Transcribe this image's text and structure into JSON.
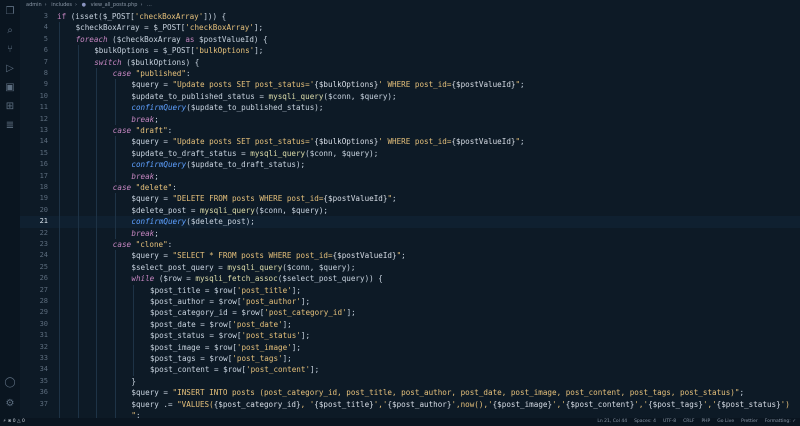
{
  "breadcrumb": [
    "admin",
    "includes",
    "view_all_posts.php",
    "..."
  ],
  "status": {
    "remote": "⚡",
    "errors": "⊗ 0 △ 0",
    "items": [
      "Ln 21, Col 44",
      "Spaces: 4",
      "UTF-8",
      "CRLF",
      "PHP",
      "Go Live",
      "Prettier",
      "Formatting: ✓"
    ]
  },
  "editor": {
    "active_line": 21
  },
  "code_lines": [
    {
      "n": 3,
      "i": 0,
      "t": [
        [
          "kw2",
          "if "
        ],
        [
          "op",
          "(isset($_POST["
        ],
        [
          "str",
          "'checkBoxArray'"
        ],
        [
          "op",
          "])) {"
        ]
      ]
    },
    {
      "n": 4,
      "i": 1,
      "t": [
        [
          "var",
          "$checkBoxArray = $_POST["
        ],
        [
          "str",
          "'checkBoxArray'"
        ],
        [
          "op",
          "];"
        ]
      ]
    },
    {
      "n": 5,
      "i": 1,
      "t": [
        [
          "kw",
          "foreach "
        ],
        [
          "op",
          "($checkBoxArray "
        ],
        [
          "kw2",
          "as "
        ],
        [
          "var",
          "$postValueId) {"
        ]
      ]
    },
    {
      "n": 6,
      "i": 2,
      "t": [
        [
          "var",
          "$bulkOptions = $_POST["
        ],
        [
          "str",
          "'bulkOptions'"
        ],
        [
          "op",
          "];"
        ]
      ]
    },
    {
      "n": 7,
      "i": 2,
      "t": [
        [
          "kw",
          "switch "
        ],
        [
          "op",
          "($bulkOptions) {"
        ]
      ]
    },
    {
      "n": 8,
      "i": 3,
      "t": [
        [
          "kw",
          "case "
        ],
        [
          "str",
          "\"published\""
        ],
        [
          "op",
          ":"
        ]
      ]
    },
    {
      "n": 9,
      "i": 4,
      "t": [
        [
          "var",
          "$query = "
        ],
        [
          "str",
          "\"Update posts SET post_status='"
        ],
        [
          "strv",
          "{$bulkOptions}"
        ],
        [
          "str",
          "' WHERE post_id="
        ],
        [
          "strv",
          "{$postValueId}"
        ],
        [
          "str",
          "\""
        ],
        [
          "op",
          ";"
        ]
      ]
    },
    {
      "n": 10,
      "i": 4,
      "t": [
        [
          "var",
          "$update_to_published_status = "
        ],
        [
          "fn",
          "mysqli_query"
        ],
        [
          "op",
          "($conn, $query);"
        ]
      ]
    },
    {
      "n": 11,
      "i": 4,
      "t": [
        [
          "fni",
          "confirmQuery"
        ],
        [
          "op",
          "($update_to_published_status);"
        ]
      ]
    },
    {
      "n": 12,
      "i": 4,
      "t": [
        [
          "kw",
          "break"
        ],
        [
          "op",
          ";"
        ]
      ]
    },
    {
      "n": 13,
      "i": 3,
      "t": [
        [
          "kw",
          "case "
        ],
        [
          "str",
          "\"draft\""
        ],
        [
          "op",
          ":"
        ]
      ]
    },
    {
      "n": 14,
      "i": 4,
      "t": [
        [
          "var",
          "$query = "
        ],
        [
          "str",
          "\"Update posts SET post_status='"
        ],
        [
          "strv",
          "{$bulkOptions}"
        ],
        [
          "str",
          "' WHERE post_id="
        ],
        [
          "strv",
          "{$postValueId}"
        ],
        [
          "str",
          "\""
        ],
        [
          "op",
          ";"
        ]
      ]
    },
    {
      "n": 15,
      "i": 4,
      "t": [
        [
          "var",
          "$update_to_draft_status = "
        ],
        [
          "fn",
          "mysqli_query"
        ],
        [
          "op",
          "($conn, $query);"
        ]
      ]
    },
    {
      "n": 16,
      "i": 4,
      "t": [
        [
          "fni",
          "confirmQuery"
        ],
        [
          "op",
          "($update_to_draft_status);"
        ]
      ]
    },
    {
      "n": 17,
      "i": 4,
      "t": [
        [
          "kw",
          "break"
        ],
        [
          "op",
          ";"
        ]
      ]
    },
    {
      "n": 18,
      "i": 3,
      "t": [
        [
          "kw",
          "case "
        ],
        [
          "str",
          "\"delete\""
        ],
        [
          "op",
          ":"
        ]
      ]
    },
    {
      "n": 19,
      "i": 4,
      "t": [
        [
          "var",
          "$query = "
        ],
        [
          "str",
          "\"DELETE FROM posts WHERE post_id="
        ],
        [
          "strv",
          "{$postValueId}"
        ],
        [
          "str",
          "\""
        ],
        [
          "op",
          ";"
        ]
      ]
    },
    {
      "n": 20,
      "i": 4,
      "t": [
        [
          "var",
          "$delete_post = "
        ],
        [
          "fn",
          "mysqli_query"
        ],
        [
          "op",
          "($conn, $query);"
        ]
      ]
    },
    {
      "n": 21,
      "i": 4,
      "t": [
        [
          "fni",
          "confirmQuery"
        ],
        [
          "op",
          "($delete_post);"
        ]
      ]
    },
    {
      "n": 22,
      "i": 4,
      "t": [
        [
          "kw",
          "break"
        ],
        [
          "op",
          ";"
        ]
      ]
    },
    {
      "n": 23,
      "i": 3,
      "t": [
        [
          "kw",
          "case "
        ],
        [
          "str",
          "\"clone\""
        ],
        [
          "op",
          ":"
        ]
      ]
    },
    {
      "n": 24,
      "i": 4,
      "t": [
        [
          "var",
          "$query = "
        ],
        [
          "str",
          "\"SELECT * FROM posts WHERE post_id="
        ],
        [
          "strv",
          "{$postValueId}"
        ],
        [
          "str",
          "\""
        ],
        [
          "op",
          ";"
        ]
      ]
    },
    {
      "n": 25,
      "i": 4,
      "t": [
        [
          "var",
          "$select_post_query = "
        ],
        [
          "fn",
          "mysqli_query"
        ],
        [
          "op",
          "($conn, $query);"
        ]
      ]
    },
    {
      "n": 26,
      "i": 4,
      "t": [
        [
          "kw",
          "while "
        ],
        [
          "op",
          "($row = "
        ],
        [
          "fn",
          "mysqli_fetch_assoc"
        ],
        [
          "op",
          "($select_post_query)) {"
        ]
      ]
    },
    {
      "n": 27,
      "i": 5,
      "t": [
        [
          "var",
          "$post_title = $row["
        ],
        [
          "str",
          "'post_title'"
        ],
        [
          "op",
          "];"
        ]
      ]
    },
    {
      "n": 28,
      "i": 5,
      "t": [
        [
          "var",
          "$post_author = $row["
        ],
        [
          "str",
          "'post_author'"
        ],
        [
          "op",
          "];"
        ]
      ]
    },
    {
      "n": 29,
      "i": 5,
      "t": [
        [
          "var",
          "$post_category_id = $row["
        ],
        [
          "str",
          "'post_category_id'"
        ],
        [
          "op",
          "];"
        ]
      ]
    },
    {
      "n": 30,
      "i": 5,
      "t": [
        [
          "var",
          "$post_date = $row["
        ],
        [
          "str",
          "'post_date'"
        ],
        [
          "op",
          "];"
        ]
      ]
    },
    {
      "n": 31,
      "i": 5,
      "t": [
        [
          "var",
          "$post_status = $row["
        ],
        [
          "str",
          "'post_status'"
        ],
        [
          "op",
          "];"
        ]
      ]
    },
    {
      "n": 32,
      "i": 5,
      "t": [
        [
          "var",
          "$post_image = $row["
        ],
        [
          "str",
          "'post_image'"
        ],
        [
          "op",
          "];"
        ]
      ]
    },
    {
      "n": 33,
      "i": 5,
      "t": [
        [
          "var",
          "$post_tags = $row["
        ],
        [
          "str",
          "'post_tags'"
        ],
        [
          "op",
          "];"
        ]
      ]
    },
    {
      "n": 34,
      "i": 5,
      "t": [
        [
          "var",
          "$post_content = $row["
        ],
        [
          "str",
          "'post_content'"
        ],
        [
          "op",
          "];"
        ]
      ]
    },
    {
      "n": 35,
      "i": 4,
      "t": [
        [
          "op",
          "}"
        ]
      ]
    },
    {
      "n": 36,
      "i": 4,
      "t": [
        [
          "var",
          "$query = "
        ],
        [
          "str",
          "\"INSERT INTO posts (post_category_id, post_title, post_author, post_date, post_image, post_content, post_tags, post_status)\""
        ],
        [
          "op",
          ";"
        ]
      ]
    },
    {
      "n": 37,
      "i": 4,
      "t": [
        [
          "var",
          "$query .= "
        ],
        [
          "str",
          "\"VALUES("
        ],
        [
          "strv",
          "{$post_category_id}"
        ],
        [
          "str",
          ", '"
        ],
        [
          "strv",
          "{$post_title}"
        ],
        [
          "str",
          "','"
        ],
        [
          "strv",
          "{$post_author}"
        ],
        [
          "str",
          "',now(),'"
        ],
        [
          "strv",
          "{$post_image}"
        ],
        [
          "str",
          "','"
        ],
        [
          "strv",
          "{$post_content}"
        ],
        [
          "str",
          "','"
        ],
        [
          "strv",
          "{$post_tags}"
        ],
        [
          "str",
          "','"
        ],
        [
          "strv",
          "{$post_status}"
        ],
        [
          "str",
          "')"
        ]
      ]
    },
    {
      "n": "",
      "i": 4,
      "t": [
        [
          "str",
          "\""
        ],
        [
          "op",
          ";"
        ]
      ]
    }
  ]
}
